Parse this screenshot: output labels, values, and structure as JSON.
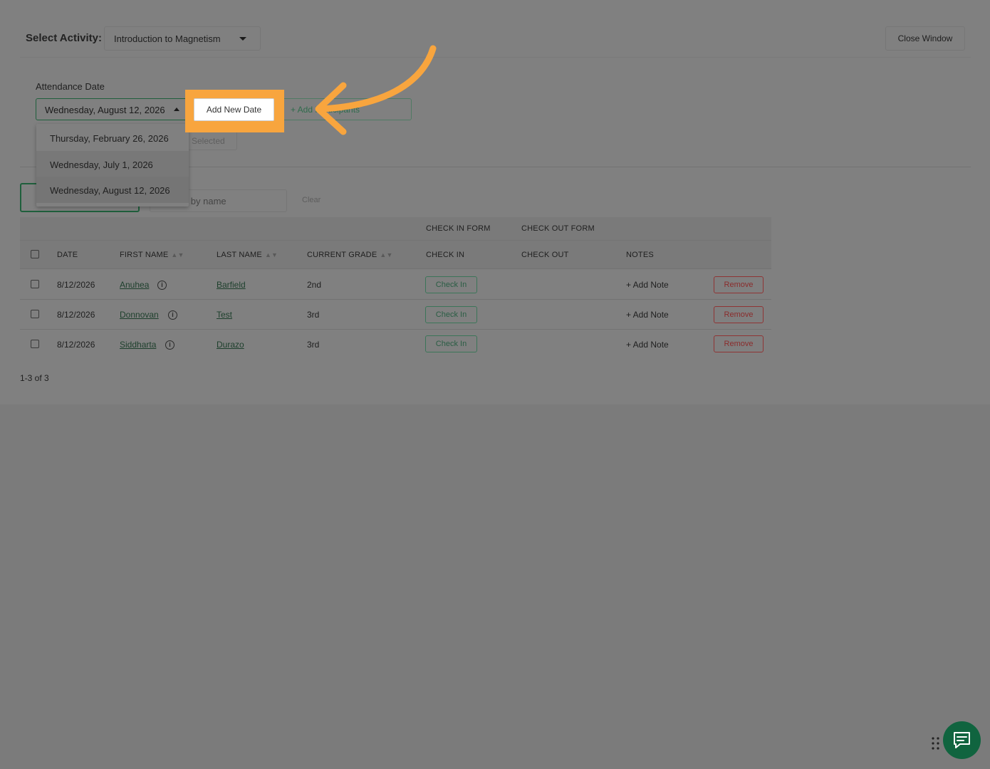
{
  "header": {
    "select_activity_label": "Select Activity:",
    "activity_selected": "Introduction to Magnetism",
    "close_window_label": "Close Window"
  },
  "attendance": {
    "label": "Attendance Date",
    "selected_date": "Wednesday, August 12, 2026",
    "add_new_date_label": "Add New Date",
    "add_participants_label": "+ Add Participants",
    "selected_button_label": "Selected",
    "dropdown_options": [
      "Thursday, February 26, 2026",
      "Wednesday, July 1, 2026",
      "Wednesday, August 12, 2026"
    ]
  },
  "search": {
    "placeholder": "Search by name",
    "clear_label": "Clear"
  },
  "table": {
    "group_headers": {
      "check_in_form": "CHECK IN FORM",
      "check_out_form": "CHECK OUT FORM"
    },
    "columns": {
      "date": "DATE",
      "first_name": "FIRST NAME",
      "last_name": "LAST NAME",
      "current_grade": "CURRENT GRADE",
      "check_in": "CHECK IN",
      "check_out": "CHECK OUT",
      "notes": "NOTES"
    },
    "rows": [
      {
        "date": "8/12/2026",
        "first_name": "Anuhea",
        "last_name": "Barfield",
        "grade": "2nd",
        "check_in": "Check In",
        "notes": "+ Add Note",
        "remove": "Remove"
      },
      {
        "date": "8/12/2026",
        "first_name": "Donnovan",
        "last_name": "Test",
        "grade": "3rd",
        "check_in": "Check In",
        "notes": "+ Add Note",
        "remove": "Remove"
      },
      {
        "date": "8/12/2026",
        "first_name": "Siddharta",
        "last_name": "Durazo",
        "grade": "3rd",
        "check_in": "Check In",
        "notes": "+ Add Note",
        "remove": "Remove"
      }
    ]
  },
  "pagination": {
    "label": "1-3 of 3"
  },
  "icons": {
    "info": "info-icon",
    "sort": "sort-icon",
    "chat": "chat-icon",
    "drag": "drag-handle-icon",
    "arrow": "annotation-arrow-icon"
  },
  "colors": {
    "highlight": "#f8a53e",
    "primary_green": "#10643f",
    "remove_red": "#8f3434"
  }
}
